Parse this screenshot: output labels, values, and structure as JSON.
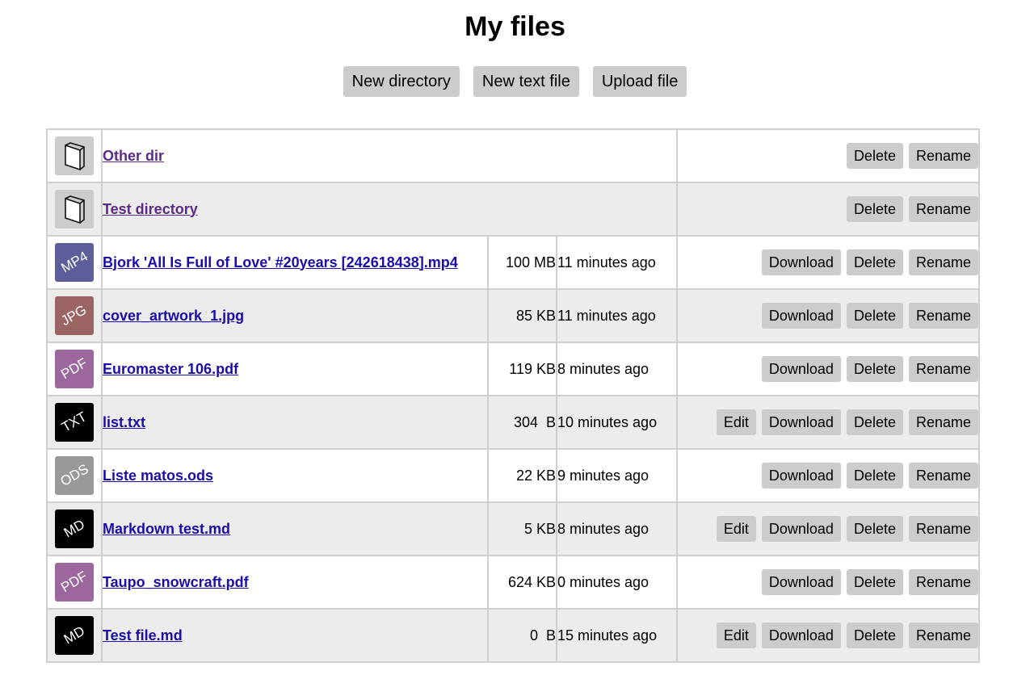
{
  "page": {
    "title": "My files"
  },
  "toolbar": {
    "new_directory": "New directory",
    "new_text_file": "New text file",
    "upload_file": "Upload file"
  },
  "colors": {
    "mp4": "#5d5d99",
    "jpg": "#9a6462",
    "pdf": "#9b679c",
    "txt": "#000000",
    "ods": "#999999",
    "md": "#000000",
    "dir": "#cccccc"
  },
  "labels": {
    "edit": "Edit",
    "download": "Download",
    "delete": "Delete",
    "rename": "Rename"
  },
  "directories": [
    {
      "name": "Other dir",
      "icon": "folder-icon"
    },
    {
      "name": "Test directory",
      "icon": "folder-icon"
    }
  ],
  "files": [
    {
      "name": "Bjork 'All Is Full of Love' #20years [242618438].mp4",
      "type": "MP4",
      "size": "100 MB",
      "modified": "11 minutes ago",
      "editable": false
    },
    {
      "name": "cover_artwork_1.jpg",
      "type": "JPG",
      "size": "85 KB",
      "modified": "11 minutes ago",
      "editable": false
    },
    {
      "name": "Euromaster 106.pdf",
      "type": "PDF",
      "size": "119 KB",
      "modified": "8 minutes ago",
      "editable": false
    },
    {
      "name": "list.txt",
      "type": "TXT",
      "size": "304  B",
      "modified": "10 minutes ago",
      "editable": true
    },
    {
      "name": "Liste matos.ods",
      "type": "ODS",
      "size": "22 KB",
      "modified": "9 minutes ago",
      "editable": false
    },
    {
      "name": "Markdown test.md",
      "type": "MD",
      "size": "5 KB",
      "modified": "8 minutes ago",
      "editable": true
    },
    {
      "name": "Taupo_snowcraft.pdf",
      "type": "PDF",
      "size": "624 KB",
      "modified": "0 minutes ago",
      "editable": false
    },
    {
      "name": "Test file.md",
      "type": "MD",
      "size": "0  B",
      "modified": "15 minutes ago",
      "editable": true
    }
  ]
}
